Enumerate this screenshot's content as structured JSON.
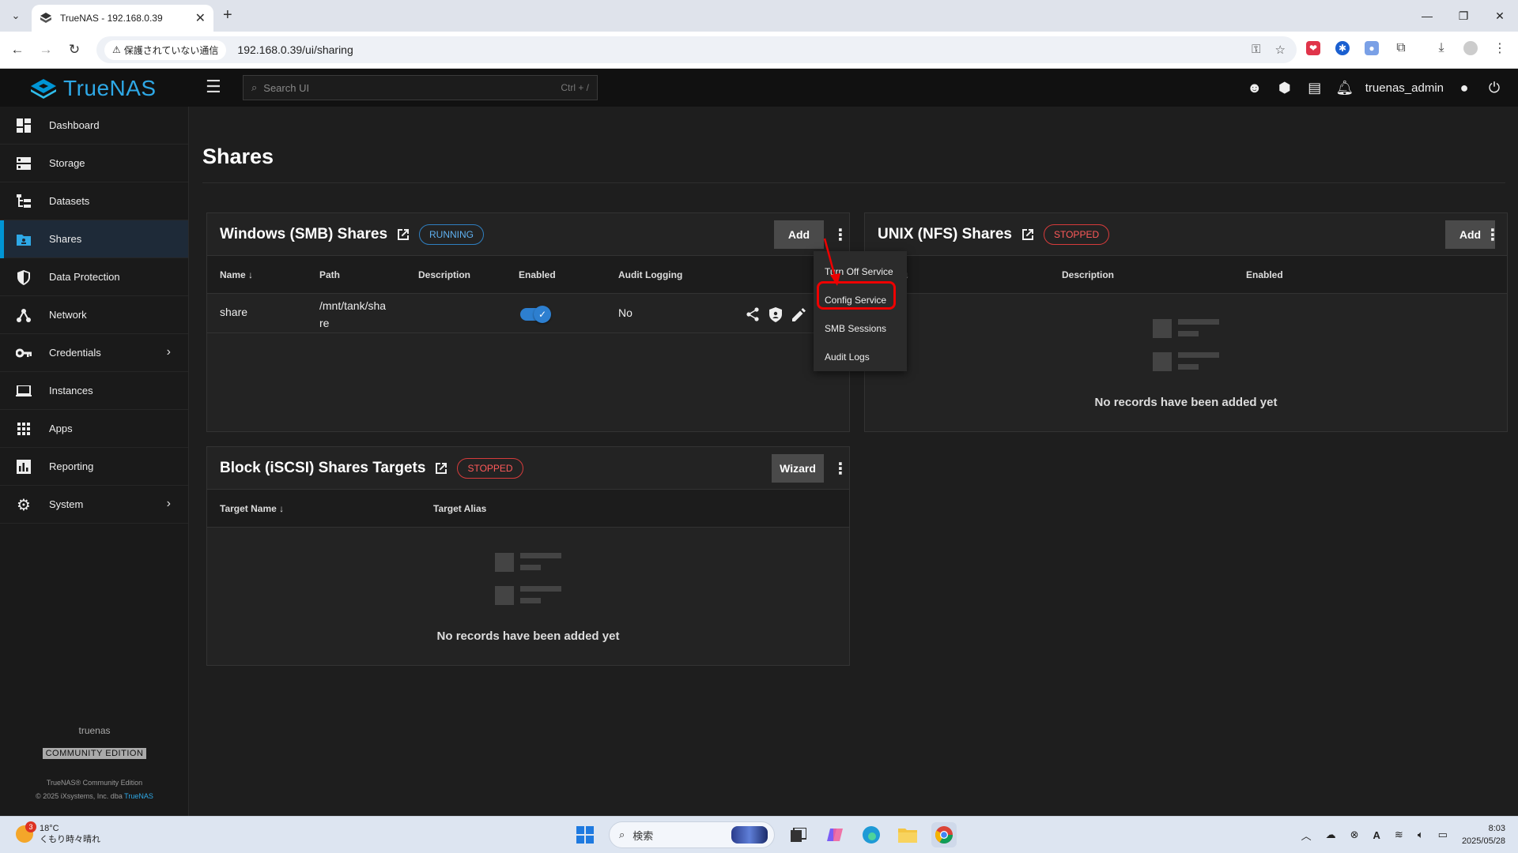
{
  "browser": {
    "tab_title": "TrueNAS - 192.168.0.39",
    "security_chip": "保護されていない通信",
    "url": "192.168.0.39/ui/sharing"
  },
  "topbar": {
    "logo_text": "TrueNAS",
    "search_placeholder": "Search UI",
    "search_shortcut": "Ctrl + /",
    "username": "truenas_admin"
  },
  "sidebar": {
    "items": [
      {
        "label": "Dashboard",
        "icon": "dashboard-icon"
      },
      {
        "label": "Storage",
        "icon": "storage-icon"
      },
      {
        "label": "Datasets",
        "icon": "datasets-icon"
      },
      {
        "label": "Shares",
        "icon": "shares-icon"
      },
      {
        "label": "Data Protection",
        "icon": "shield-icon"
      },
      {
        "label": "Network",
        "icon": "network-icon"
      },
      {
        "label": "Credentials",
        "icon": "key-icon"
      },
      {
        "label": "Instances",
        "icon": "laptop-icon"
      },
      {
        "label": "Apps",
        "icon": "apps-icon"
      },
      {
        "label": "Reporting",
        "icon": "chart-icon"
      },
      {
        "label": "System",
        "icon": "gear-icon"
      }
    ],
    "active": "Shares",
    "hostname": "truenas",
    "edition": "COMMUNITY EDITION",
    "copyright_line1": "TrueNAS® Community Edition",
    "copyright_line2": "© 2025 iXsystems, Inc. dba",
    "copyright_link": "TrueNAS"
  },
  "main": {
    "page_title": "Shares",
    "smb": {
      "title": "Windows (SMB) Shares",
      "status": "RUNNING",
      "add_label": "Add",
      "columns": [
        "Name",
        "Path",
        "Description",
        "Enabled",
        "Audit Logging"
      ],
      "rows": [
        {
          "name": "share",
          "path_line1": "/mnt/tank/sha",
          "path_line2": "re",
          "description": "",
          "enabled": true,
          "audit_logging": "No"
        }
      ]
    },
    "nfs": {
      "title": "UNIX (NFS) Shares",
      "status": "STOPPED",
      "add_label": "Add",
      "columns": [
        "Description",
        "Enabled"
      ],
      "empty_text": "No records have been added yet"
    },
    "iscsi": {
      "title": "Block (iSCSI) Shares Targets",
      "status": "STOPPED",
      "wizard_label": "Wizard",
      "columns": [
        "Target Name",
        "Target Alias"
      ],
      "empty_text": "No records have been added yet"
    }
  },
  "menu": {
    "items": [
      "Turn Off Service",
      "Config Service",
      "SMB Sessions",
      "Audit Logs"
    ],
    "highlighted": "Config Service"
  },
  "taskbar": {
    "weather_temp": "18°C",
    "weather_desc": "くもり時々晴れ",
    "weather_badge": "3",
    "search_placeholder": "検索",
    "time": "8:03",
    "date": "2025/05/28"
  },
  "colors": {
    "accent": "#0095d5",
    "running": "#5fb0f0",
    "stopped": "#ff5a5a",
    "highlight_box": "#e00000"
  }
}
